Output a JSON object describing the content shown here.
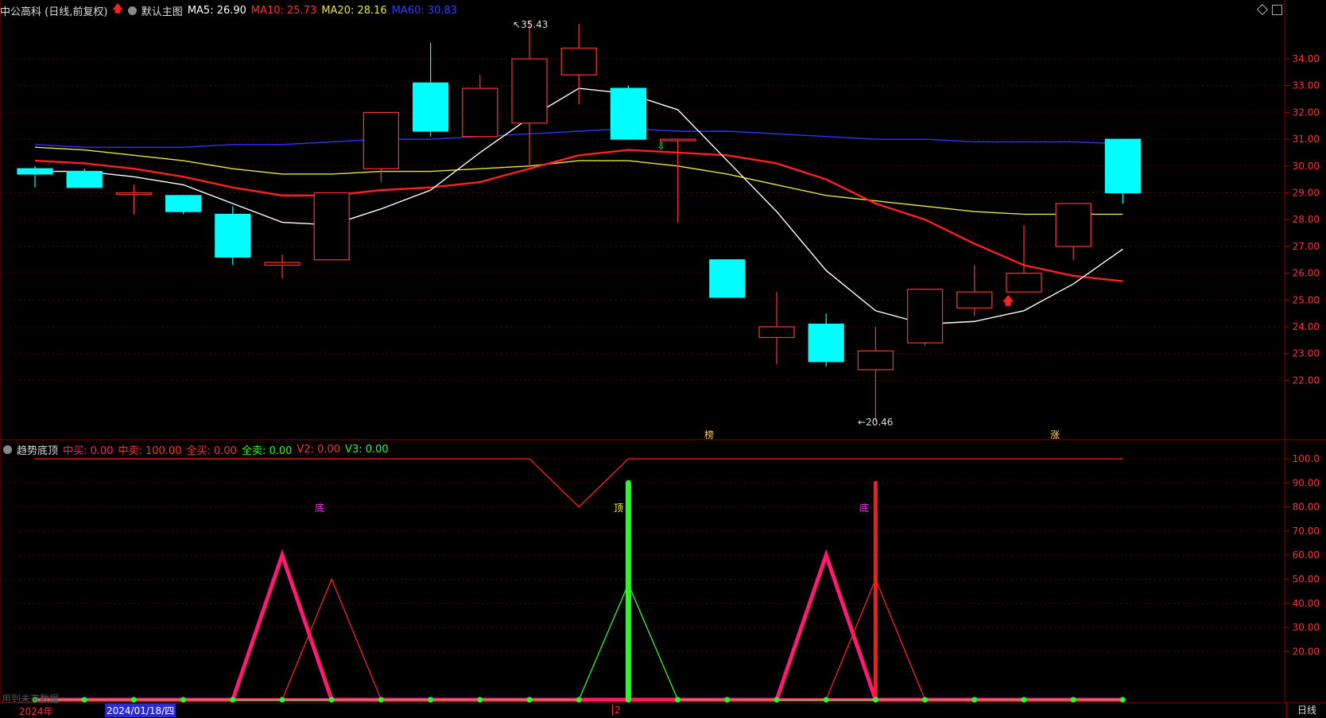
{
  "main_header": {
    "stock_name": "中公高科 (日线,前复权)",
    "chart_name": "默认主图",
    "ma5": "MA5: 26.90",
    "ma10": "MA10: 25.73",
    "ma20": "MA20: 28.16",
    "ma60": "MA60: 30.83"
  },
  "sub_header": {
    "indicator_name": "趋势底顶",
    "zhongmai": "中买: 0.00",
    "zhongmai_sell": "中卖: 100.00",
    "quanmai": "全买: 0.00",
    "quanmai_sell": "全卖: 0.00",
    "v2": "V2: 0.00",
    "v3": "V3: 0.00"
  },
  "price_axis": [
    "34.00",
    "33.00",
    "32.00",
    "31.00",
    "30.00",
    "29.00",
    "28.00",
    "27.00",
    "26.00",
    "25.00",
    "24.00",
    "23.00",
    "22.00"
  ],
  "indicator_axis": [
    "100.0",
    "90.00",
    "80.00",
    "70.00",
    "60.00",
    "50.00",
    "40.00",
    "30.00",
    "20.00"
  ],
  "annotations": {
    "high": "35.43",
    "low": "20.46",
    "bang": "榜",
    "zhang": "涨",
    "di1": "底",
    "ding": "顶",
    "di2": "底"
  },
  "footer": {
    "year": "2024年",
    "date": "2024/01/18/四",
    "marker": "2",
    "period": "日线",
    "watermark": "用到未来数据"
  },
  "colors": {
    "up": "#ff3232",
    "down": "#00ffff",
    "ma5": "#ffffff",
    "ma10": "#ff2020",
    "ma20": "#e8e83a",
    "ma60": "#3030ff",
    "pink": "#ff1a75",
    "green": "#22ff22"
  },
  "chart_data": {
    "type": "candlestick",
    "candles": [
      {
        "open": 29.9,
        "close": 29.7,
        "high": 30.0,
        "low": 29.2
      },
      {
        "open": 29.8,
        "close": 29.2,
        "high": 29.9,
        "low": 29.2
      },
      {
        "open": 29.0,
        "close": 29.0,
        "high": 29.3,
        "low": 28.2
      },
      {
        "open": 28.9,
        "close": 28.3,
        "high": 28.9,
        "low": 28.2
      },
      {
        "open": 28.2,
        "close": 26.6,
        "high": 28.5,
        "low": 26.3
      },
      {
        "open": 26.3,
        "close": 26.4,
        "high": 26.7,
        "low": 25.8
      },
      {
        "open": 26.5,
        "close": 29.0,
        "high": 29.0,
        "low": 26.5
      },
      {
        "open": 29.9,
        "close": 32.0,
        "high": 32.0,
        "low": 29.4
      },
      {
        "open": 33.1,
        "close": 31.3,
        "high": 34.6,
        "low": 31.1
      },
      {
        "open": 31.1,
        "close": 32.9,
        "high": 33.4,
        "low": 31.1
      },
      {
        "open": 31.6,
        "close": 34.0,
        "high": 35.4,
        "low": 30.0
      },
      {
        "open": 33.4,
        "close": 34.4,
        "high": 35.3,
        "low": 32.3
      },
      {
        "open": 32.9,
        "close": 31.0,
        "high": 33.0,
        "low": 31.0
      },
      {
        "open": 31.0,
        "close": 31.0,
        "high": 31.0,
        "low": 27.9
      },
      {
        "open": 26.5,
        "close": 25.1,
        "high": 26.5,
        "low": 25.1
      },
      {
        "open": 23.6,
        "close": 24.0,
        "high": 25.3,
        "low": 22.6
      },
      {
        "open": 24.1,
        "close": 22.7,
        "high": 24.5,
        "low": 22.5
      },
      {
        "open": 22.4,
        "close": 23.1,
        "high": 24.0,
        "low": 20.46
      },
      {
        "open": 23.4,
        "close": 25.4,
        "high": 25.4,
        "low": 23.3
      },
      {
        "open": 24.7,
        "close": 25.3,
        "high": 26.3,
        "low": 24.4
      },
      {
        "open": 25.3,
        "close": 26.0,
        "high": 27.8,
        "low": 25.3
      },
      {
        "open": 27.0,
        "close": 28.6,
        "high": 28.6,
        "low": 26.5
      },
      {
        "open": 31.0,
        "close": 29.0,
        "high": 31.0,
        "low": 28.6
      }
    ],
    "ma5": [
      29.8,
      29.8,
      29.6,
      29.3,
      28.6,
      27.9,
      27.8,
      28.4,
      29.1,
      30.5,
      31.8,
      32.9,
      32.7,
      32.1,
      30.2,
      28.3,
      26.1,
      24.6,
      24.1,
      24.2,
      24.6,
      25.6,
      26.9
    ],
    "ma10": [
      30.2,
      30.1,
      29.9,
      29.6,
      29.2,
      28.9,
      28.9,
      29.1,
      29.2,
      29.4,
      29.9,
      30.4,
      30.6,
      30.5,
      30.4,
      30.1,
      29.5,
      28.6,
      28.0,
      27.1,
      26.3,
      25.9,
      25.7
    ],
    "ma20": [
      30.7,
      30.6,
      30.4,
      30.2,
      29.9,
      29.7,
      29.7,
      29.8,
      29.8,
      29.9,
      30.0,
      30.2,
      30.2,
      30.0,
      29.7,
      29.3,
      28.9,
      28.7,
      28.5,
      28.3,
      28.2,
      28.2,
      28.2
    ],
    "ma60": [
      30.8,
      30.7,
      30.7,
      30.7,
      30.8,
      30.8,
      30.9,
      31.0,
      31.0,
      31.1,
      31.2,
      31.3,
      31.4,
      31.3,
      31.3,
      31.2,
      31.1,
      31.0,
      31.0,
      30.9,
      30.9,
      30.9,
      30.83
    ],
    "indicator": {
      "zhongmai_sell_line": [
        100,
        100,
        100,
        100,
        100,
        100,
        100,
        100,
        100,
        100,
        100,
        80,
        100,
        100,
        100,
        100,
        100,
        100,
        100,
        100,
        100,
        100,
        100
      ],
      "pink_peaks": [
        0,
        0,
        0,
        0,
        0,
        60,
        0,
        0,
        0,
        0,
        0,
        0,
        0,
        0,
        0,
        0,
        60,
        0,
        0,
        0,
        0,
        0,
        0
      ],
      "red_peaks": [
        0,
        0,
        0,
        0,
        0,
        0,
        50,
        0,
        0,
        0,
        0,
        0,
        0,
        0,
        0,
        0,
        0,
        50,
        0,
        0,
        0,
        0,
        0
      ],
      "green_peaks": [
        0,
        0,
        0,
        0,
        0,
        0,
        0,
        0,
        0,
        0,
        0,
        0,
        48,
        0,
        0,
        0,
        0,
        0,
        0,
        0,
        0,
        0,
        0
      ],
      "green_bar_index": 12,
      "green_bar_value": 90,
      "red_bar_index": 17,
      "red_bar_value": 90,
      "di_indices": [
        6,
        17
      ],
      "ding_index": 12
    }
  }
}
